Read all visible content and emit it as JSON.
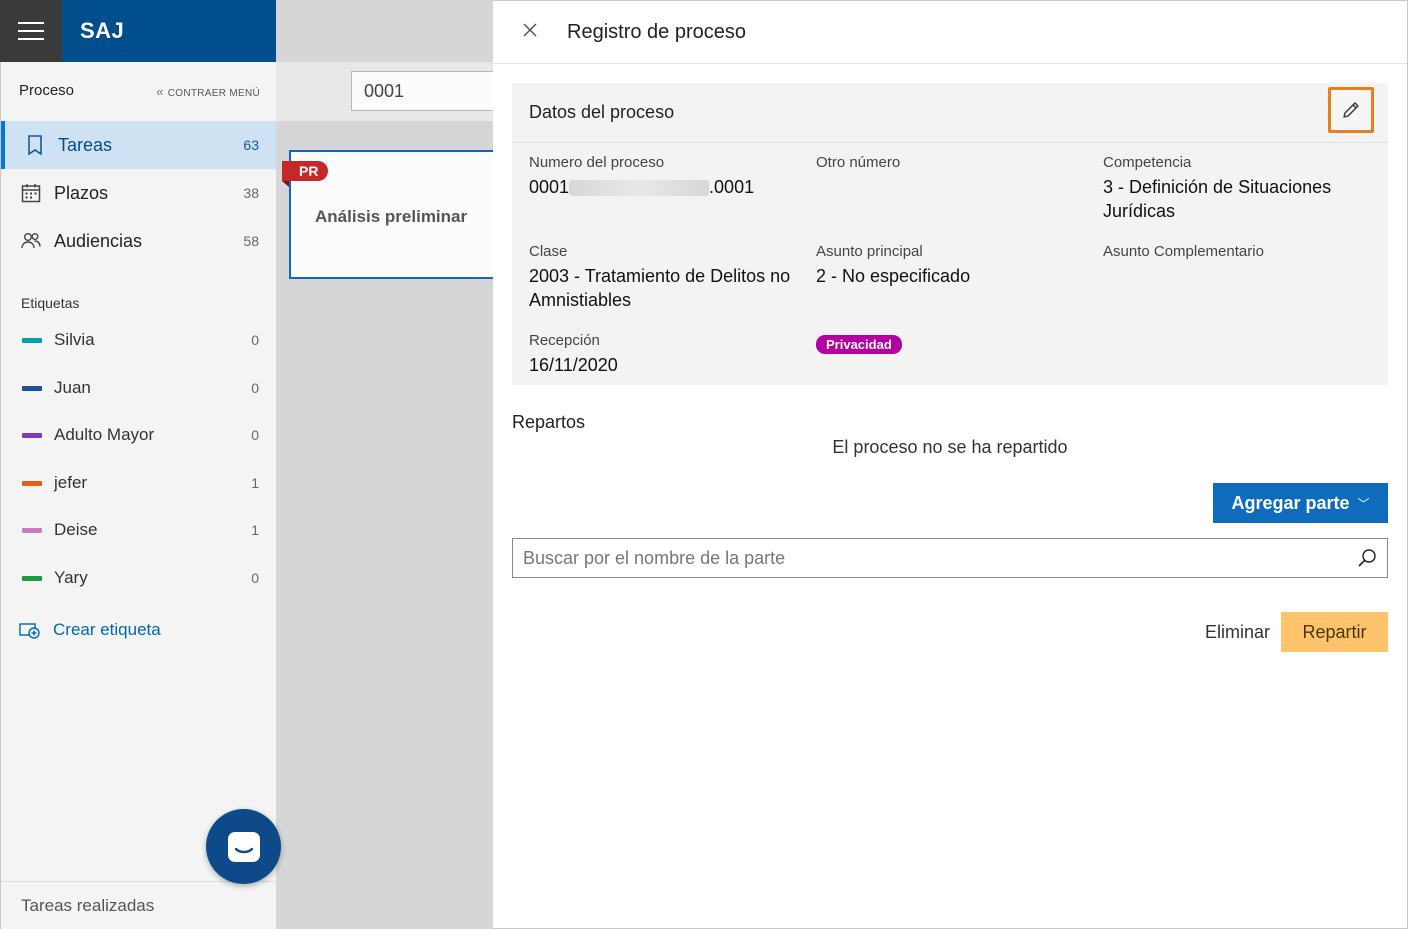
{
  "app": {
    "brand": "SAJ"
  },
  "sidebar": {
    "section_title": "Proceso",
    "collapse_label": "CONTRAER MENÚ",
    "nav": [
      {
        "label": "Tareas",
        "count": "63",
        "icon": "bookmark-icon",
        "active": true
      },
      {
        "label": "Plazos",
        "count": "38",
        "icon": "calendar-icon",
        "active": false
      },
      {
        "label": "Audiencias",
        "count": "58",
        "icon": "people-icon",
        "active": false
      }
    ],
    "tags_title": "Etiquetas",
    "tags": [
      {
        "label": "Silvia",
        "count": "0",
        "color": "#00a0a8"
      },
      {
        "label": "Juan",
        "count": "0",
        "color": "#1f4e9c"
      },
      {
        "label": "Adulto Mayor",
        "count": "0",
        "color": "#7a3fb8"
      },
      {
        "label": "jefer",
        "count": "1",
        "color": "#e0601a"
      },
      {
        "label": "Deise",
        "count": "1",
        "color": "#c77cc0"
      },
      {
        "label": "Yary",
        "count": "0",
        "color": "#1e9a3c"
      }
    ],
    "create_tag": "Crear etiqueta",
    "footer": "Tareas realizadas"
  },
  "middle": {
    "search_value": "0001",
    "card": {
      "badge": "PR",
      "title": "Análisis preliminar"
    }
  },
  "panel": {
    "title": "Registro de proceso",
    "section": {
      "title": "Datos del proceso",
      "fields": {
        "numero": {
          "label": "Numero del proceso",
          "prefix": "0001",
          "suffix": ".0001"
        },
        "otro": {
          "label": "Otro número",
          "value": ""
        },
        "competencia": {
          "label": "Competencia",
          "value": "3 - Definición de Situaciones Jurídicas"
        },
        "clase": {
          "label": "Clase",
          "value": "2003 - Tratamiento de Delitos no Amnistiables"
        },
        "asunto_principal": {
          "label": "Asunto principal",
          "value": "2 - No especificado"
        },
        "asunto_complementario": {
          "label": "Asunto Complementario",
          "value": ""
        },
        "recepcion": {
          "label": "Recepción",
          "value": "16/11/2020"
        }
      },
      "privacy_badge": "Privacidad"
    },
    "repartos": {
      "title": "Repartos",
      "empty": "El proceso no se ha repartido",
      "add_button": "Agregar parte",
      "search_placeholder": "Buscar por el nombre de la parte",
      "delete_button": "Eliminar",
      "distribute_button": "Repartir"
    }
  }
}
